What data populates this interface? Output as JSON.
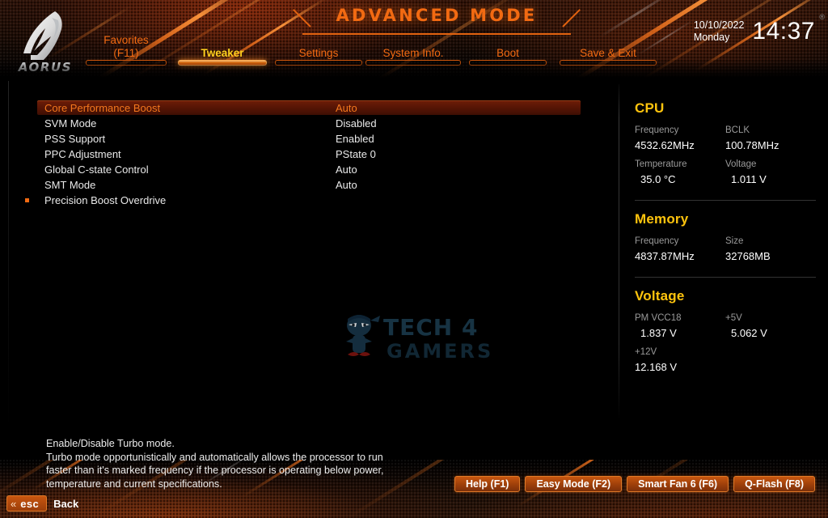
{
  "header": {
    "logo_text": "AORUS",
    "title": "ADVANCED MODE",
    "date": "10/10/2022",
    "day": "Monday",
    "time": "14:37",
    "registered_mark": "®",
    "tabs": [
      {
        "label": "Favorites\n(F11)",
        "active": false,
        "name": "tab-favorites"
      },
      {
        "label": "Tweaker",
        "active": true,
        "name": "tab-tweaker"
      },
      {
        "label": "Settings",
        "active": false,
        "name": "tab-settings"
      },
      {
        "label": "System Info.",
        "active": false,
        "name": "tab-system-info"
      },
      {
        "label": "Boot",
        "active": false,
        "name": "tab-boot"
      },
      {
        "label": "Save & Exit",
        "active": false,
        "name": "tab-save-exit"
      }
    ]
  },
  "settings": {
    "rows": [
      {
        "name": "Core Performance Boost",
        "value": "Auto",
        "selected": true,
        "submenu": false
      },
      {
        "name": "SVM Mode",
        "value": "Disabled",
        "selected": false,
        "submenu": false
      },
      {
        "name": "PSS Support",
        "value": "Enabled",
        "selected": false,
        "submenu": false
      },
      {
        "name": "PPC Adjustment",
        "value": "PState 0",
        "selected": false,
        "submenu": false
      },
      {
        "name": "Global C-state Control",
        "value": "Auto",
        "selected": false,
        "submenu": false
      },
      {
        "name": "SMT Mode",
        "value": "Auto",
        "selected": false,
        "submenu": false
      },
      {
        "name": "Precision Boost Overdrive",
        "value": "",
        "selected": false,
        "submenu": true
      }
    ]
  },
  "watermark": {
    "line1": "TECH 4",
    "line2": "GAMERS"
  },
  "monitor": {
    "sections": [
      {
        "title": "CPU",
        "cells": [
          {
            "label": "Frequency",
            "value": "4532.62MHz",
            "indent": false
          },
          {
            "label": "BCLK",
            "value": "100.78MHz",
            "indent": false
          },
          {
            "label": "Temperature",
            "value": "35.0 °C",
            "indent": true
          },
          {
            "label": "Voltage",
            "value": "1.011 V",
            "indent": true
          }
        ]
      },
      {
        "title": "Memory",
        "cells": [
          {
            "label": "Frequency",
            "value": "4837.87MHz",
            "indent": false
          },
          {
            "label": "Size",
            "value": "32768MB",
            "indent": false
          }
        ]
      },
      {
        "title": "Voltage",
        "cells": [
          {
            "label": "PM VCC18",
            "value": "1.837 V",
            "indent": true
          },
          {
            "label": "+5V",
            "value": "5.062 V",
            "indent": true
          },
          {
            "label": "+12V",
            "value": "12.168 V",
            "indent": false
          },
          {
            "label": "",
            "value": "",
            "indent": false
          }
        ]
      }
    ]
  },
  "help": {
    "line1": "Enable/Disable Turbo mode.",
    "line2": "Turbo mode opportunistically and automatically allows the processor to run",
    "line3": "faster than it's marked frequency if the processor is operating below power,",
    "line4": "temperature and current specifications."
  },
  "footer": {
    "buttons": [
      {
        "label": "Help (F1)",
        "name": "help-button"
      },
      {
        "label": "Easy Mode (F2)",
        "name": "easy-mode-button"
      },
      {
        "label": "Smart Fan 6 (F6)",
        "name": "smart-fan-button"
      },
      {
        "label": "Q-Flash (F8)",
        "name": "q-flash-button"
      }
    ],
    "esc_key": "esc",
    "back_label": "Back",
    "chevron": "«"
  },
  "colors": {
    "accent_orange": "#f26a12",
    "active_yellow": "#ffd21e",
    "monitor_yellow": "#ffc40d",
    "selected_row_bg": "#571505",
    "text_white": "#e9e9e9",
    "label_gray": "#9a9a9a"
  }
}
